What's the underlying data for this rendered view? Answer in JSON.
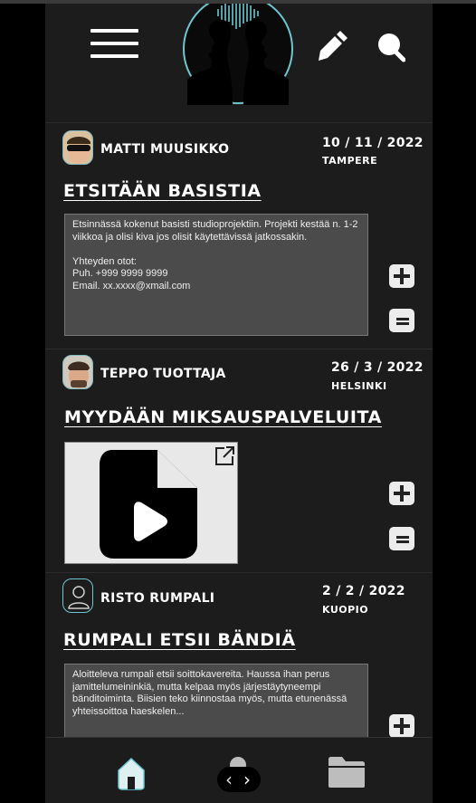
{
  "posts": [
    {
      "author": "MATTI MUUSIKKO",
      "date": "10 / 11 / 2022",
      "city": "TAMPERE",
      "title": "ETSITÄÄN BASISTIA",
      "description": "Etsinnässä kokenut basisti studioprojektiin. Projekti kestää n. 1-2 viikkoa ja olisi kiva jos olisit käytettävissä jatkossakin.\n\nYhteyden otot:\nPuh. +999 9999 9999\nEmail. xx.xxxx@xmail.com"
    },
    {
      "author": "TEPPO TUOTTAJA",
      "date": "26 / 3 / 2022",
      "city": "HELSINKI",
      "title": "MYYDÄÄN MIKSAUSPALVELUITA"
    },
    {
      "author": "RISTO RUMPALI",
      "date": "2 / 2 / 2022",
      "city": "KUOPIO",
      "title": "RUMPALI ETSII BÄNDIÄ",
      "description": "Aloitteleva rumpali etsii soittokavereita. Haussa ihan perus jamittelumeininkiä, mutta kelpaa myös järjestäytyneempi bänditoiminta. Biisien teko kiinnostaa myös, mutta etunenässä yhteissoittoa haeskelen..."
    }
  ],
  "pager": {
    "prev": "‹",
    "next": "›"
  },
  "icons": {
    "menu": "hamburger-icon",
    "logo": "silhouettes-logo",
    "edit": "pencil-icon",
    "search": "search-icon",
    "add": "plus-icon",
    "remove": "minus-icon",
    "external": "external-link-icon",
    "video": "video-file-icon",
    "home": "home-icon",
    "profile": "user-icon",
    "folder": "folder-icon"
  },
  "colors": {
    "background": "#1c1c1c",
    "accent": "#6fc6d0",
    "panel": "#4b4b4b"
  }
}
